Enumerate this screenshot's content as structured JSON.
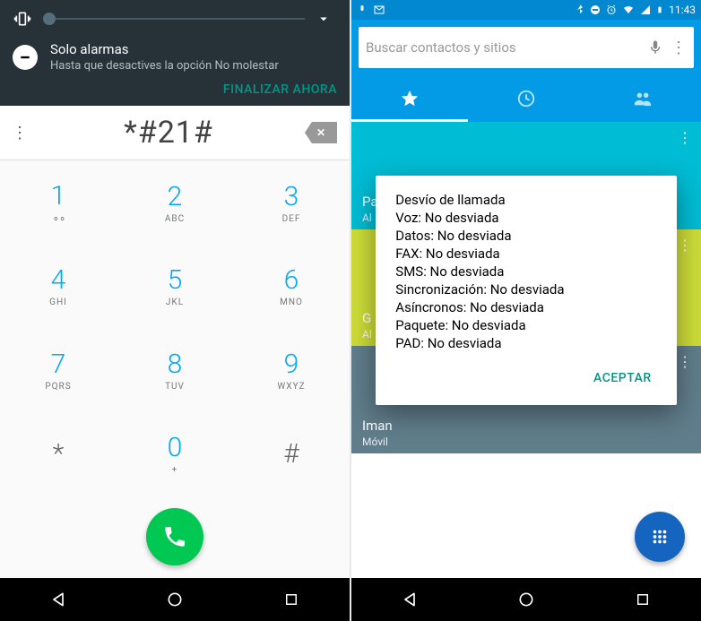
{
  "left": {
    "shade": {
      "vibrate_icon": "vibrate",
      "expand_icon": "chevron-down",
      "notif_title": "Solo alarmas",
      "notif_sub": "Hasta que desactives la opción No molestar",
      "action": "FINALIZAR AHORA"
    },
    "dialer": {
      "number": "*#21#",
      "keys": [
        {
          "num": "1",
          "letters": "",
          "vm": true
        },
        {
          "num": "2",
          "letters": "ABC"
        },
        {
          "num": "3",
          "letters": "DEF"
        },
        {
          "num": "4",
          "letters": "GHI"
        },
        {
          "num": "5",
          "letters": "JKL"
        },
        {
          "num": "6",
          "letters": "MNO"
        },
        {
          "num": "7",
          "letters": "PQRS"
        },
        {
          "num": "8",
          "letters": "TUV"
        },
        {
          "num": "9",
          "letters": "WXYZ"
        },
        {
          "num": "*",
          "letters": "",
          "neutral": true
        },
        {
          "num": "0",
          "letters": "+"
        },
        {
          "num": "#",
          "letters": "",
          "neutral": true
        }
      ]
    }
  },
  "right": {
    "status": {
      "time": "11:43"
    },
    "search": {
      "placeholder": "Buscar contactos y sitios"
    },
    "tiles": [
      {
        "name": "Pa",
        "sub": "Al"
      },
      {
        "name": "G",
        "sub": "Al"
      },
      {
        "name": "Iman",
        "sub": "Móvil"
      }
    ],
    "dialog": {
      "lines": [
        "Desvío de llamada",
        "Voz: No desviada",
        "Datos: No desviada",
        "FAX: No desviada",
        "SMS: No desviada",
        "Sincronización: No desviada",
        "Asíncronos: No desviada",
        "Paquete: No desviada",
        "PAD: No desviada"
      ],
      "button": "ACEPTAR"
    }
  }
}
